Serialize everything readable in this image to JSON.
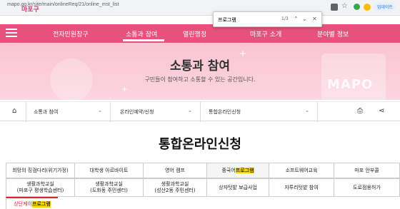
{
  "browser": {
    "url": "mapo.go.kr/site/main/onlineReq/21/online_mst_list",
    "update_label": "업데이트",
    "find_query": "프로그램",
    "find_count": "1/3"
  },
  "site": {
    "logo_fragment": "마포구"
  },
  "nav": {
    "items": [
      "전자민원창구",
      "소통과 참여",
      "열린행정",
      "마포구 소개",
      "분야별 정보"
    ]
  },
  "hero": {
    "title": "소통과 참여",
    "subtitle": "구민들이 참여하고 소통할 수 있는 공간입니다.",
    "watermark": "MAPO"
  },
  "breadcrumb": {
    "level1": "소통과 참여",
    "level2": "온라인예약/신청",
    "level3": "통합온라인신청"
  },
  "page": {
    "title": "통합온라인신청"
  },
  "categories": {
    "row1": [
      "희망의 징검다리(위기가정)",
      "대학생 아르바이트",
      "영어 캠프",
      "중국어",
      "소프트웨어교육",
      "마포 안부콜"
    ],
    "row1_highlight": "프로그램",
    "row2": [
      "생활과학교실\n(마포구 평생학습센터)",
      "생활과학교실\n(도화동 주민센터)",
      "생활과학교실\n(성산2동 주민센터)",
      "상자텃밭 보급사업",
      "자투리텃밭 참여",
      "도로점용허가"
    ],
    "row3_prefix": "상단케이",
    "row3_highlight": "프로그램"
  }
}
